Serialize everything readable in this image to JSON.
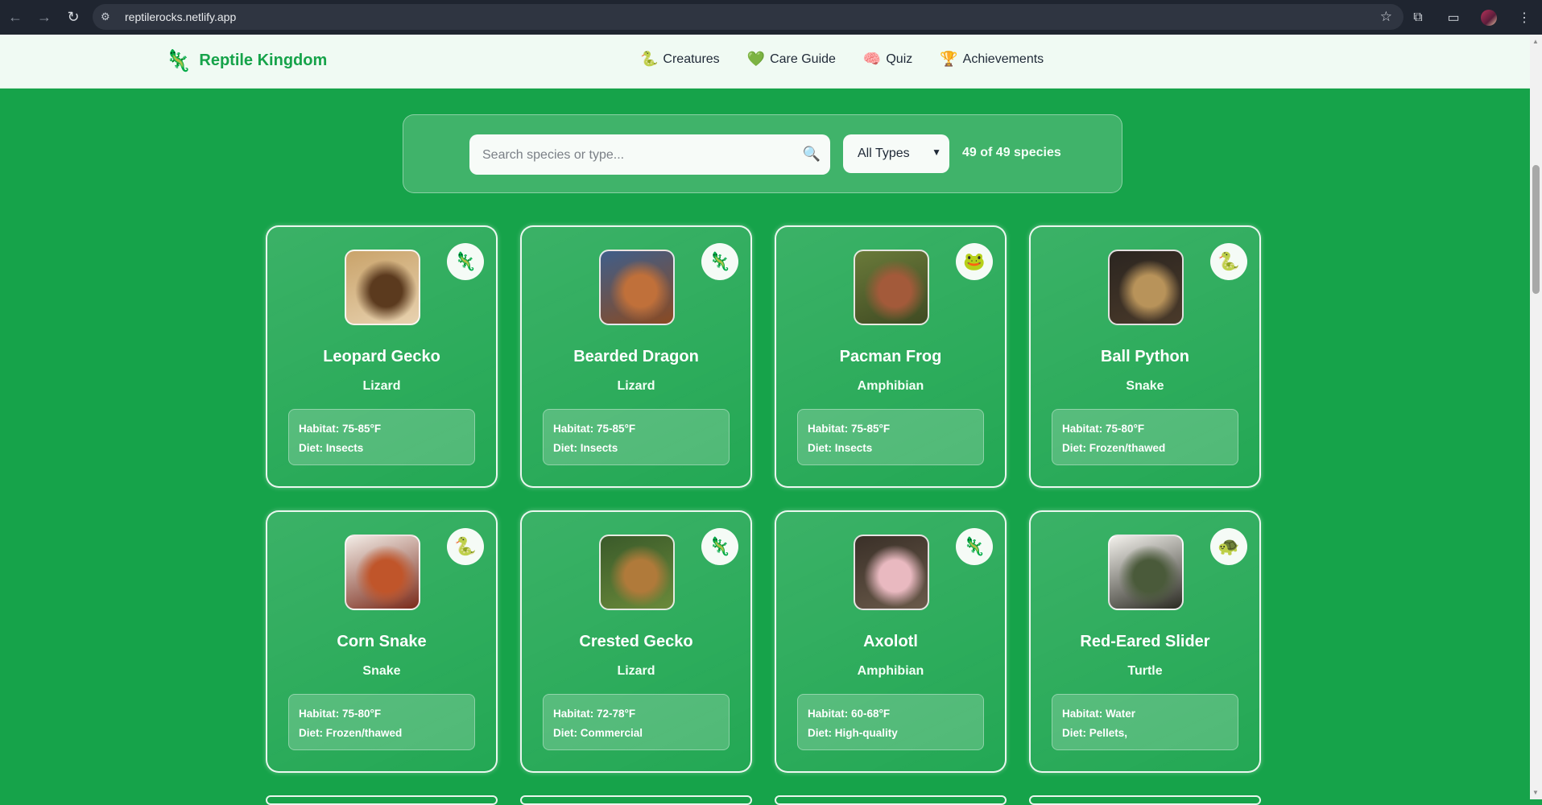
{
  "browser": {
    "url": "reptilerocks.netlify.app",
    "icons": [
      "back-icon",
      "forward-icon",
      "reload-icon",
      "site-info-icon",
      "star-icon",
      "extensions-icon",
      "media-icon",
      "profile-avatar",
      "menu-icon"
    ]
  },
  "header": {
    "brand": "Reptile Kingdom",
    "brand_icon": "🦎",
    "nav": [
      {
        "label": "Creatures",
        "icon": "🐍"
      },
      {
        "label": "Care Guide",
        "icon": "💚"
      },
      {
        "label": "Quiz",
        "icon": "🧠"
      },
      {
        "label": "Achievements",
        "icon": "🏆"
      }
    ]
  },
  "search": {
    "placeholder": "Search species or type...",
    "value": "",
    "filter_selected": "All Types",
    "count_text": "49 of 49 species"
  },
  "cards": [
    {
      "name": "Leopard Gecko",
      "type": "Lizard",
      "habitat": "Habitat: 75-85°F",
      "diet": "Diet: Insects",
      "badge": "🦎",
      "photo_colors": [
        "#c9a36a",
        "#5b3a1e",
        "#e8d2b0"
      ]
    },
    {
      "name": "Bearded Dragon",
      "type": "Lizard",
      "habitat": "Habitat: 75-85°F",
      "diet": "Diet: Insects",
      "badge": "🦎",
      "photo_colors": [
        "#3f5e8a",
        "#c0703a",
        "#8a4a22"
      ]
    },
    {
      "name": "Pacman Frog",
      "type": "Amphibian",
      "habitat": "Habitat: 75-85°F",
      "diet": "Diet: Insects",
      "badge": "🐸",
      "photo_colors": [
        "#6a7a3a",
        "#a35a3a",
        "#3f4a22"
      ]
    },
    {
      "name": "Ball Python",
      "type": "Snake",
      "habitat": "Habitat: 75-80°F",
      "diet": "Diet: Frozen/thawed",
      "badge": "🐍",
      "photo_colors": [
        "#2b2520",
        "#b8935a",
        "#4a3a2a"
      ]
    },
    {
      "name": "Corn Snake",
      "type": "Snake",
      "habitat": "Habitat: 75-80°F",
      "diet": "Diet: Frozen/thawed",
      "badge": "🐍",
      "photo_colors": [
        "#f2ece6",
        "#c0552a",
        "#7a2a1a"
      ]
    },
    {
      "name": "Crested Gecko",
      "type": "Lizard",
      "habitat": "Habitat: 72-78°F",
      "diet": "Diet: Commercial",
      "badge": "🦎",
      "photo_colors": [
        "#3a5a2a",
        "#b07a3a",
        "#6a8a3a"
      ]
    },
    {
      "name": "Axolotl",
      "type": "Amphibian",
      "habitat": "Habitat: 60-68°F",
      "diet": "Diet: High-quality",
      "badge": "🦎",
      "photo_colors": [
        "#3a3028",
        "#e9b9c0",
        "#6a5a4a"
      ]
    },
    {
      "name": "Red-Eared Slider",
      "type": "Turtle",
      "habitat": "Habitat: Water",
      "diet": "Diet: Pellets,",
      "badge": "🐢",
      "photo_colors": [
        "#f3f1ec",
        "#4a5a3a",
        "#2a2a22"
      ]
    }
  ],
  "colors": {
    "page_bg": "#16a34a",
    "brand": "#16a34a",
    "header_bg": "#f0faf3"
  }
}
